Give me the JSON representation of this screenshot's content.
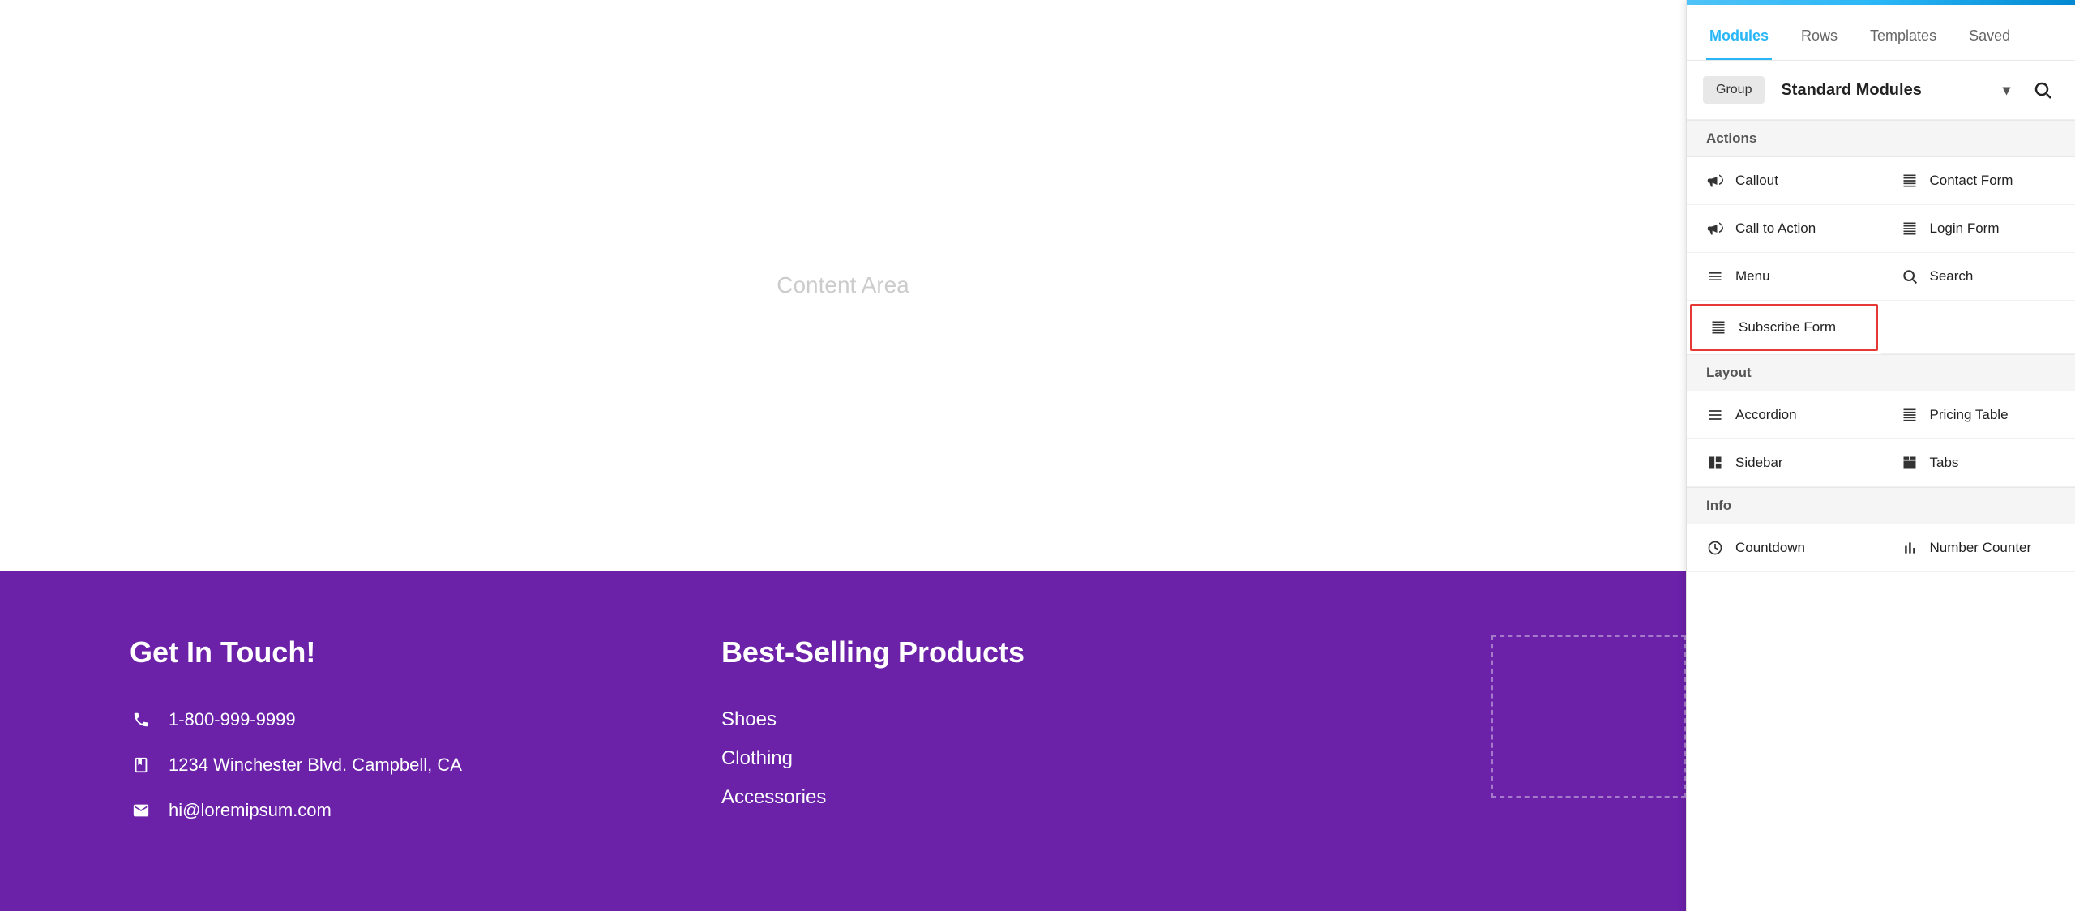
{
  "main": {
    "content_area_label": "Content Area"
  },
  "footer": {
    "contact_heading": "Get In Touch!",
    "phone": "1-800-999-9999",
    "address": "1234 Winchester Blvd. Campbell, CA",
    "email": "hi@loremipsum.com",
    "products_heading": "Best-Selling Products",
    "products": [
      "Shoes",
      "Clothing",
      "Accessories"
    ]
  },
  "panel": {
    "tabs": [
      {
        "label": "Modules",
        "active": true
      },
      {
        "label": "Rows",
        "active": false
      },
      {
        "label": "Templates",
        "active": false
      },
      {
        "label": "Saved",
        "active": false
      }
    ],
    "group_label": "Group",
    "group_selected": "Standard Modules",
    "sections": [
      {
        "name": "Actions",
        "items": [
          {
            "label": "Callout",
            "icon": "megaphone",
            "col": 1,
            "highlighted": false
          },
          {
            "label": "Contact Form",
            "icon": "table",
            "col": 2,
            "highlighted": false
          },
          {
            "label": "Call to Action",
            "icon": "megaphone",
            "col": 1,
            "highlighted": false
          },
          {
            "label": "Login Form",
            "icon": "table",
            "col": 2,
            "highlighted": false
          },
          {
            "label": "Menu",
            "icon": "menu",
            "col": 1,
            "highlighted": false
          },
          {
            "label": "Search",
            "icon": "search",
            "col": 2,
            "highlighted": false
          },
          {
            "label": "Subscribe Form",
            "icon": "table",
            "col": 1,
            "highlighted": true
          }
        ]
      },
      {
        "name": "Layout",
        "items": [
          {
            "label": "Accordion",
            "icon": "accordion",
            "col": 1,
            "highlighted": false
          },
          {
            "label": "Pricing Table",
            "icon": "table",
            "col": 2,
            "highlighted": false
          },
          {
            "label": "Sidebar",
            "icon": "sidebar",
            "col": 1,
            "highlighted": false
          },
          {
            "label": "Tabs",
            "icon": "tabs",
            "col": 2,
            "highlighted": false
          }
        ]
      },
      {
        "name": "Info",
        "items": [
          {
            "label": "Countdown",
            "icon": "clock",
            "col": 1,
            "highlighted": false
          },
          {
            "label": "Number Counter",
            "icon": "bar-chart",
            "col": 2,
            "highlighted": false
          }
        ]
      }
    ]
  }
}
